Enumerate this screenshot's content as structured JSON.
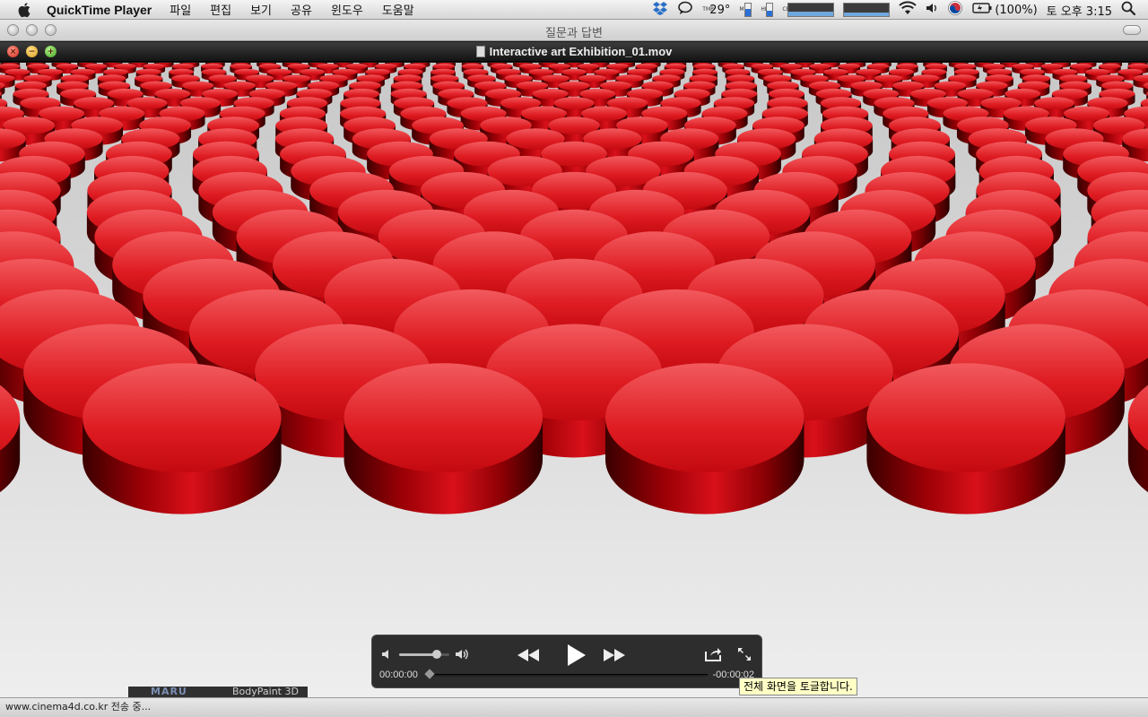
{
  "menubar": {
    "app_name": "QuickTime Player",
    "items": [
      "파일",
      "편집",
      "보기",
      "공유",
      "윈도우",
      "도움말"
    ],
    "status": {
      "temperature": "29°",
      "temp_label": "TMP",
      "mem_label": "MEM",
      "hd_label": "HD",
      "cpu_label": "CPU",
      "battery": "(100%)",
      "clock": "토 오후 3:15"
    }
  },
  "background_window": {
    "title": "질문과 답변"
  },
  "player_window": {
    "title": "Interactive art Exhibition_01.mov"
  },
  "controller": {
    "current_time": "00:00:00",
    "remaining_time": "-00:00:02",
    "volume_level": 0.75
  },
  "tooltip": {
    "text": "전체 화면을 토글합니다."
  },
  "behind": {
    "maru": "MARU",
    "bodypaint": "BodyPaint 3D"
  },
  "statusbar": {
    "text": "www.cinema4d.co.kr 전송 중..."
  },
  "colors": {
    "disc_red": "#d40a12",
    "hud_bg": "#121212"
  }
}
